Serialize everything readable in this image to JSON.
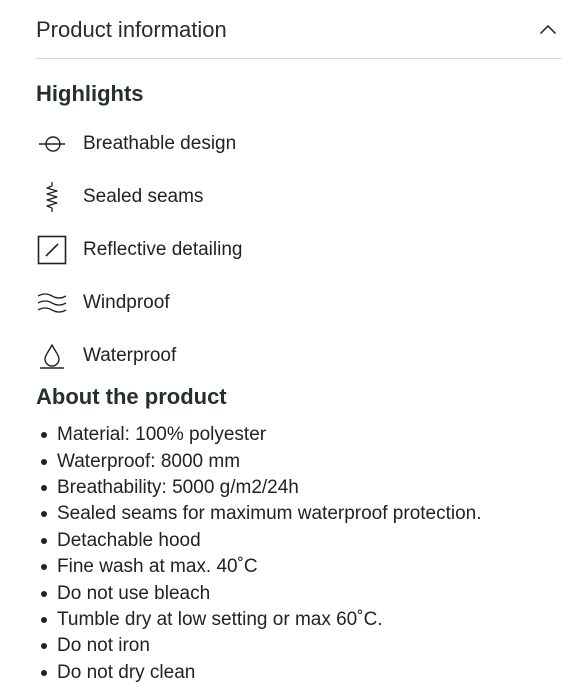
{
  "header": {
    "title": "Product information",
    "toggle_icon": "chevron-up-icon"
  },
  "highlights": {
    "title": "Highlights",
    "items": [
      {
        "icon": "breathable-icon",
        "label": "Breathable design"
      },
      {
        "icon": "sealed-seams-icon",
        "label": "Sealed seams"
      },
      {
        "icon": "reflective-icon",
        "label": "Reflective detailing"
      },
      {
        "icon": "wind-icon",
        "label": "Windproof"
      },
      {
        "icon": "water-drop-icon",
        "label": "Waterproof"
      }
    ]
  },
  "about": {
    "title": "About the product",
    "items": [
      "Material: 100% polyester",
      "Waterproof: 8000 mm",
      "Breathability: 5000 g/m2/24h",
      "Sealed seams for maximum waterproof protection.",
      "Detachable hood",
      "Fine wash at max. 40˚C",
      "Do not use bleach",
      "Tumble dry at low setting or max 60˚C.",
      "Do not iron",
      "Do not dry clean"
    ]
  }
}
